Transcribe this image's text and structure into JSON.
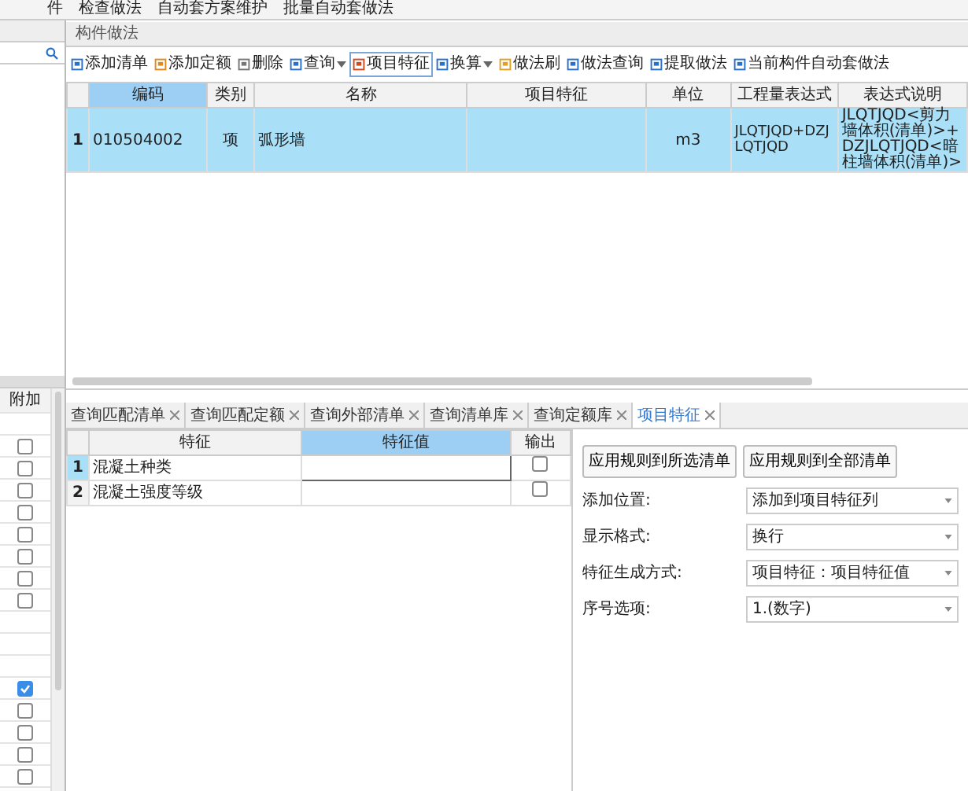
{
  "top_toolbar": [
    "件",
    "检查做法",
    "自动套方案维护",
    "批量自动套做法"
  ],
  "left_panel": {
    "column": "附加",
    "rows": [
      {
        "kind": "blank"
      },
      {
        "kind": "checkbox",
        "checked": false
      },
      {
        "kind": "checkbox",
        "checked": false
      },
      {
        "kind": "checkbox",
        "checked": false
      },
      {
        "kind": "checkbox",
        "checked": false
      },
      {
        "kind": "checkbox",
        "checked": false
      },
      {
        "kind": "checkbox",
        "checked": false
      },
      {
        "kind": "checkbox",
        "checked": false
      },
      {
        "kind": "checkbox",
        "checked": false
      },
      {
        "kind": "blank"
      },
      {
        "kind": "blank"
      },
      {
        "kind": "blank"
      },
      {
        "kind": "checkbox",
        "checked": true
      },
      {
        "kind": "checkbox",
        "checked": false
      },
      {
        "kind": "checkbox",
        "checked": false
      },
      {
        "kind": "checkbox",
        "checked": false
      },
      {
        "kind": "checkbox",
        "checked": false
      }
    ]
  },
  "panel_title": "构件做法",
  "toolbar": [
    {
      "label": "添加清单",
      "dropdown": false,
      "highlighted": false
    },
    {
      "label": "添加定额",
      "dropdown": false,
      "highlighted": false
    },
    {
      "label": "删除",
      "dropdown": false,
      "highlighted": false
    },
    {
      "label": "查询",
      "dropdown": true,
      "highlighted": false
    },
    {
      "label": "项目特征",
      "dropdown": false,
      "highlighted": true
    },
    {
      "label": "换算",
      "dropdown": true,
      "highlighted": false
    },
    {
      "label": "做法刷",
      "dropdown": false,
      "highlighted": false
    },
    {
      "label": "做法查询",
      "dropdown": false,
      "highlighted": false
    },
    {
      "label": "提取做法",
      "dropdown": false,
      "highlighted": false
    },
    {
      "label": "当前构件自动套做法",
      "dropdown": false,
      "highlighted": false
    }
  ],
  "table": {
    "columns": [
      "编码",
      "类别",
      "名称",
      "项目特征",
      "单位",
      "工程量表达式",
      "表达式说明"
    ],
    "rows": [
      {
        "number": "1",
        "selected": true,
        "cells": [
          "010504002",
          "项",
          "弧形墙",
          "",
          "m3",
          "JLQTJQD+DZJLQTJQD",
          "JLQTJQD<剪力墙体积(清单)>+DZJLQTJQD<暗柱墙体积(清单)>"
        ]
      }
    ]
  },
  "tabs": [
    {
      "label": "查询匹配清单",
      "selected": false
    },
    {
      "label": "查询匹配定额",
      "selected": false
    },
    {
      "label": "查询外部清单",
      "selected": false
    },
    {
      "label": "查询清单库",
      "selected": false
    },
    {
      "label": "查询定额库",
      "selected": false
    },
    {
      "label": "项目特征",
      "selected": true
    }
  ],
  "features": {
    "columns": [
      "特征",
      "特征值",
      "输出"
    ],
    "rows": [
      {
        "number": "1",
        "selected": true,
        "feature": "混凝土种类",
        "value": "",
        "output": false
      },
      {
        "number": "2",
        "selected": false,
        "feature": "混凝土强度等级",
        "value": "",
        "output": false
      }
    ]
  },
  "settings": {
    "buttons": [
      "应用规则到所选清单",
      "应用规则到全部清单"
    ],
    "fields": [
      {
        "label": "添加位置:",
        "value": "添加到项目特征列"
      },
      {
        "label": "显示格式:",
        "value": "换行"
      },
      {
        "label": "特征生成方式:",
        "value": "项目特征：项目特征值"
      },
      {
        "label": "序号选项:",
        "value": "1.(数字)"
      }
    ]
  }
}
